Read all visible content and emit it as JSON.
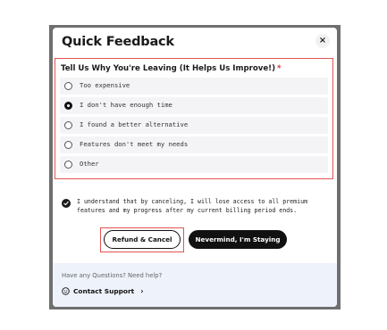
{
  "modal": {
    "title": "Quick Feedback",
    "close_label": "×"
  },
  "question": {
    "label": "Tell Us Why You're Leaving (It Helps Us Improve!)",
    "required_mark": "*"
  },
  "options": [
    {
      "label": "Too expensive",
      "selected": false
    },
    {
      "label": "I don't have enough time",
      "selected": true
    },
    {
      "label": "I found a better alternative",
      "selected": false
    },
    {
      "label": "Features don't meet my needs",
      "selected": false
    },
    {
      "label": "Other",
      "selected": false
    }
  ],
  "consent": {
    "text": "I understand that by canceling, I will lose access to all premium features and my progress after my current billing period ends.",
    "checked": true
  },
  "buttons": {
    "refund_label": "Refund & Cancel",
    "stay_label": "Nevermind, I'm Staying"
  },
  "footer": {
    "help_text": "Have any Questions? Need help?",
    "support_label": "Contact Support",
    "chevron": "›"
  },
  "colors": {
    "highlight": "#e0554f",
    "primary": "#111111",
    "footer_bg": "#eef2fb"
  },
  "icons": {
    "close": "close-icon",
    "support": "support-icon",
    "check": "check-icon"
  }
}
